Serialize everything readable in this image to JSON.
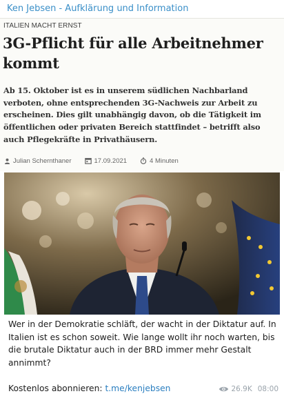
{
  "channel": {
    "name": "Ken Jebsen - Aufklärung und Information"
  },
  "article": {
    "kicker": "ITALIEN MACHT ERNST",
    "headline": "3G-Pflicht für alle Arbeitnehmer kommt",
    "lead": "Ab 15. Oktober ist es in unserem südlichen Nachbarland verboten, ohne entsprechenden 3G-Nachweis zur Arbeit zu erscheinen. Dies gilt unabhängig davon, ob die Tätigkeit im öffentlichen oder privaten Bereich stattfindet – betrifft also auch Pflegekräfte in Privathäusern.",
    "author": "Julian Schernthaner",
    "date": "17.09.2021",
    "read_time": "4 Minuten"
  },
  "message": {
    "text": "Wer in der Demokratie schläft, der wacht in der Diktatur auf. In Italien ist es schon soweit. Wie lange wollt ihr noch warten, bis die brutale Diktatur auch in der BRD immer mehr Gestalt annimmt?",
    "subscribe_prefix": "Kostenlos abonnieren: ",
    "subscribe_link": "t.me/kenjebsen"
  },
  "footer": {
    "views": "26.9K",
    "time": "08:00"
  },
  "icons": {
    "author": "person-icon",
    "date": "calendar-icon",
    "time": "stopwatch-icon",
    "views": "eye-icon"
  },
  "colors": {
    "channel": "#3a8fc8",
    "link": "#2a7ec0",
    "meta": "#9aa3ab"
  }
}
